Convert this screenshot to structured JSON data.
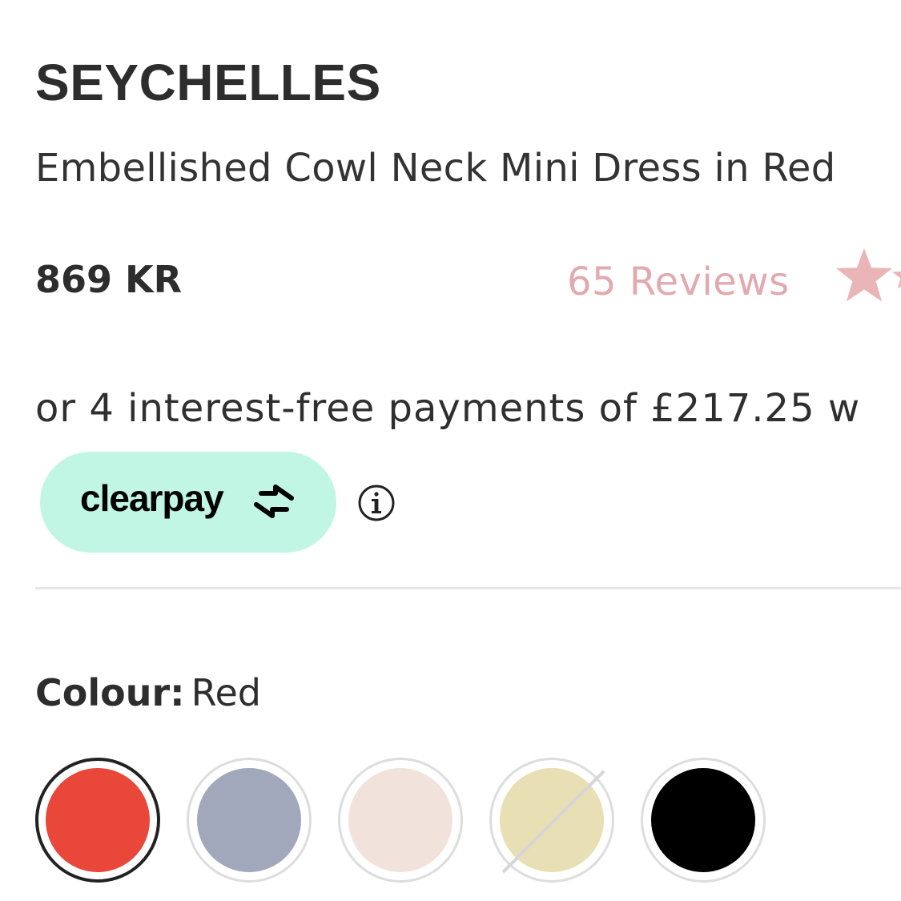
{
  "product": {
    "brand": "SEYCHELLES",
    "name": "Embellished Cowl Neck Mini Dress in Red",
    "price": "869 KR",
    "reviews_label": "65 Reviews"
  },
  "payment": {
    "installments_text": "or 4 interest-free payments of £217.25 w",
    "provider_label": "clearpay",
    "provider_color": "#c0f6e3",
    "info_icon": "info-circle-icon"
  },
  "colour": {
    "label": "Colour:",
    "selected": "Red",
    "swatches": [
      {
        "color": "#e8473a",
        "selected": true,
        "available": true
      },
      {
        "color": "#a2a8bb",
        "selected": false,
        "available": true
      },
      {
        "color": "#f1e2dc",
        "selected": false,
        "available": true
      },
      {
        "color": "#e9dfb5",
        "selected": false,
        "available": false
      },
      {
        "color": "#000000",
        "selected": false,
        "available": true
      }
    ]
  },
  "theme": {
    "review_color": "#e2a9ae",
    "star_color": "#eab5b6"
  }
}
